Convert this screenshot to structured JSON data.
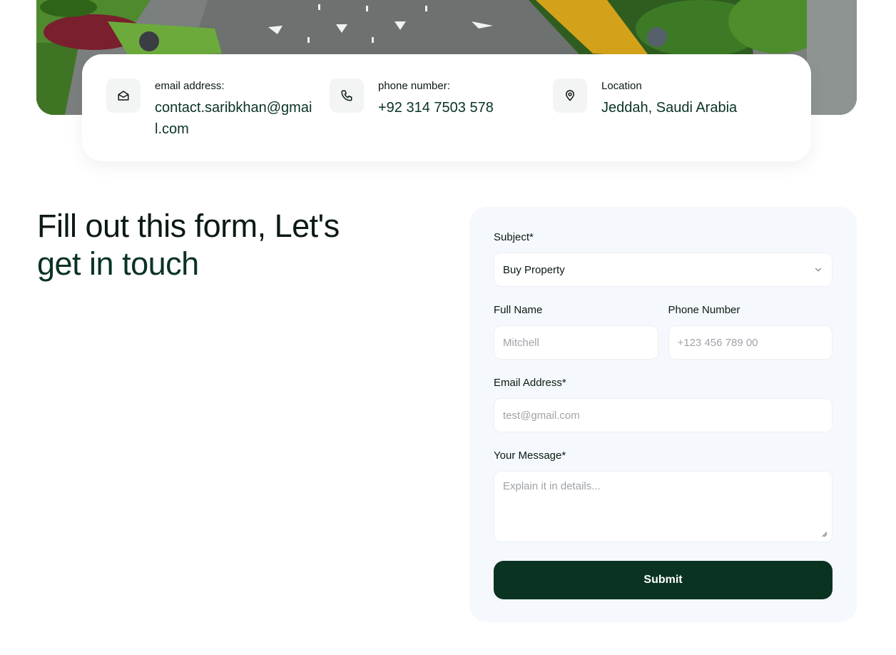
{
  "contact": {
    "items": [
      {
        "icon": "mail-open-icon",
        "label": "email address:",
        "value": "contact.saribkhan@gmail.com"
      },
      {
        "icon": "phone-icon",
        "label": "phone number:",
        "value": "+92 314 7503 578"
      },
      {
        "icon": "location-pin-icon",
        "label": "Location",
        "value": "Jeddah, Saudi Arabia"
      }
    ]
  },
  "heading": {
    "line1": "Fill out this form, Let's",
    "line2": "get in touch"
  },
  "form": {
    "subject": {
      "label": "Subject*",
      "value": "Buy Property"
    },
    "full_name": {
      "label": "Full Name",
      "placeholder": "Mitchell"
    },
    "phone": {
      "label": "Phone Number",
      "placeholder": "+123 456 789 00"
    },
    "email": {
      "label": "Email Address*",
      "placeholder": "test@gmail.com"
    },
    "message": {
      "label": "Your Message*",
      "placeholder": "Explain it in details..."
    },
    "submit_label": "Submit"
  },
  "colors": {
    "brand_dark_green": "#0a3322",
    "form_background": "#f5f8fc",
    "icon_background": "#f3f4f4"
  }
}
